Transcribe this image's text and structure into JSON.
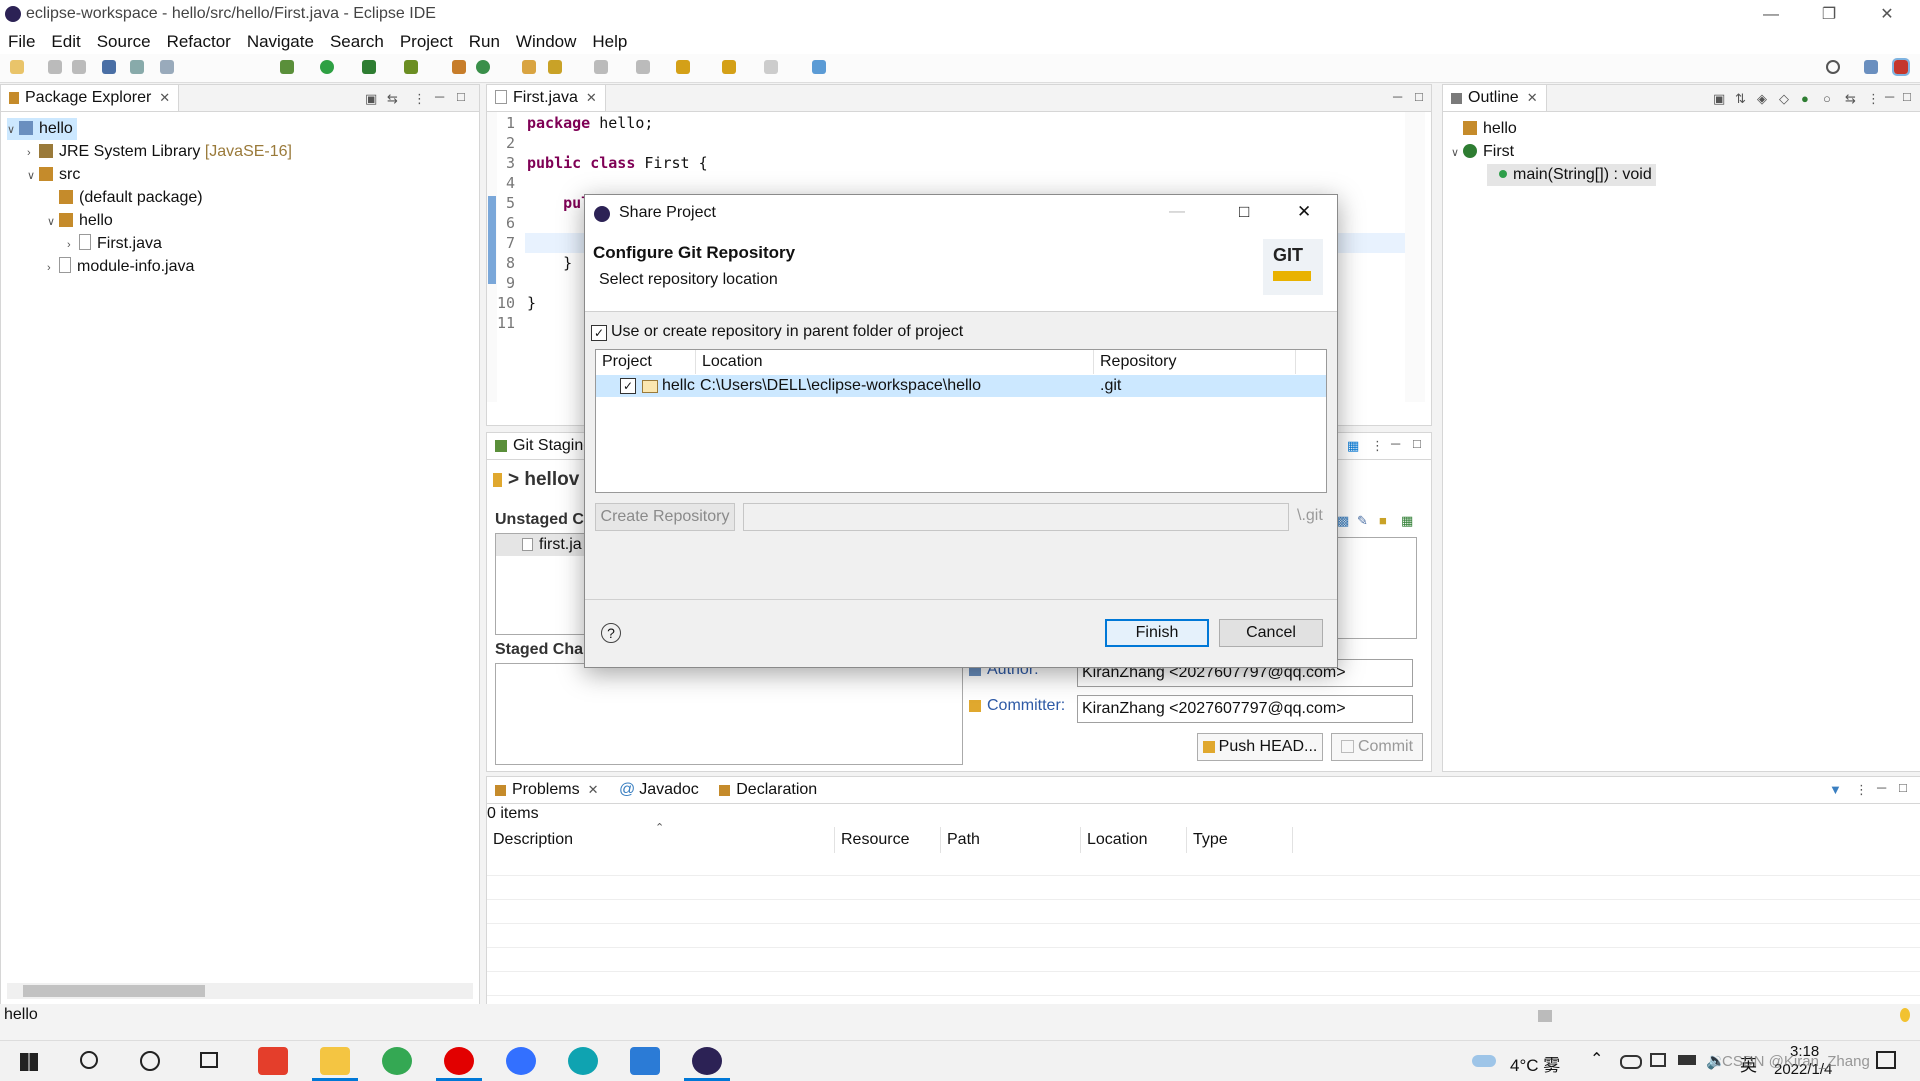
{
  "window": {
    "title": "eclipse-workspace - hello/src/hello/First.java - Eclipse IDE"
  },
  "menu": [
    "File",
    "Edit",
    "Source",
    "Refactor",
    "Navigate",
    "Search",
    "Project",
    "Run",
    "Window",
    "Help"
  ],
  "package_explorer": {
    "tab": "Package Explorer",
    "tree": [
      {
        "label": "hello",
        "indent": 0,
        "chev": "v",
        "icon": "project-icon",
        "selected": true
      },
      {
        "label": "JRE System Library",
        "suffix": "[JavaSE-16]",
        "indent": 1,
        "chev": ">",
        "icon": "library-icon"
      },
      {
        "label": "src",
        "indent": 1,
        "chev": "v",
        "icon": "source-folder-icon"
      },
      {
        "label": "(default package)",
        "indent": 2,
        "chev": "",
        "icon": "package-icon"
      },
      {
        "label": "hello",
        "indent": 2,
        "chev": "v",
        "icon": "package-icon"
      },
      {
        "label": "First.java",
        "indent": 3,
        "chev": ">",
        "icon": "java-file-icon"
      },
      {
        "label": "module-info.java",
        "indent": 2,
        "chev": ">",
        "icon": "java-file-icon"
      }
    ]
  },
  "editor": {
    "tab": "First.java",
    "line_numbers": [
      "1",
      "2",
      "3",
      "4",
      "5",
      "6",
      "7",
      "8",
      "9",
      "10",
      "11"
    ],
    "lines": [
      {
        "kw": "package",
        "rest": " hello;"
      },
      {
        "kw": "",
        "rest": ""
      },
      {
        "kw": "public class",
        "rest": " First {"
      },
      {
        "kw": "",
        "rest": ""
      },
      {
        "kw": "",
        "rest": "    pul"
      },
      {
        "kw": "",
        "rest": ""
      },
      {
        "kw": "",
        "rest": ""
      },
      {
        "kw": "",
        "rest": "    }"
      },
      {
        "kw": "",
        "rest": ""
      },
      {
        "kw": "",
        "rest": "}"
      },
      {
        "kw": "",
        "rest": ""
      }
    ]
  },
  "outline": {
    "tab": "Outline",
    "items": [
      {
        "label": "hello",
        "indent": 0,
        "chev": "",
        "icon": "package-icon"
      },
      {
        "label": "First",
        "indent": 0,
        "chev": "v",
        "icon": "class-icon"
      },
      {
        "label": "main(String[]) : void",
        "indent": 1,
        "chev": "",
        "icon": "method-icon",
        "selected": true
      }
    ]
  },
  "git_staging": {
    "tab": "Git Staging",
    "repo": "> hellov",
    "unstaged_label": "Unstaged C",
    "unstaged_file": "first.ja",
    "staged_label": "Staged Char",
    "author_label": "Author:",
    "author_value": "KiranZhang <2027607797@qq.com>",
    "committer_label": "Committer:",
    "committer_value": "KiranZhang <2027607797@qq.com>",
    "push_label": "Push HEAD...",
    "commit_label": "Commit"
  },
  "problems": {
    "tabs": [
      "Problems",
      "Javadoc",
      "Declaration"
    ],
    "count": "0 items",
    "columns": [
      "Description",
      "Resource",
      "Path",
      "Location",
      "Type"
    ]
  },
  "status_bar": {
    "text": "hello"
  },
  "dialog": {
    "title": "Share Project",
    "heading": "Configure Git Repository",
    "subheading": "Select repository location",
    "git_logo": "GIT",
    "checkbox_label": "Use or create repository in parent folder of project",
    "columns": [
      "Project",
      "Location",
      "Repository"
    ],
    "row": {
      "project": "hellc",
      "location": "C:\\Users\\DELL\\eclipse-workspace\\hello",
      "repository": ".git"
    },
    "create_repo_label": "Create Repository",
    "git_suffix": "\\.git",
    "finish_label": "Finish",
    "cancel_label": "Cancel",
    "help_glyph": "?"
  },
  "taskbar": {
    "weather": "4°C 雾",
    "ime": "英",
    "time": "3:18",
    "date": "2022/1/4",
    "watermark": "CSDN @Kiran_Zhang"
  },
  "colors": {
    "accent": "#0078d7",
    "selection": "#cce8ff",
    "keyword": "#7f0055"
  }
}
